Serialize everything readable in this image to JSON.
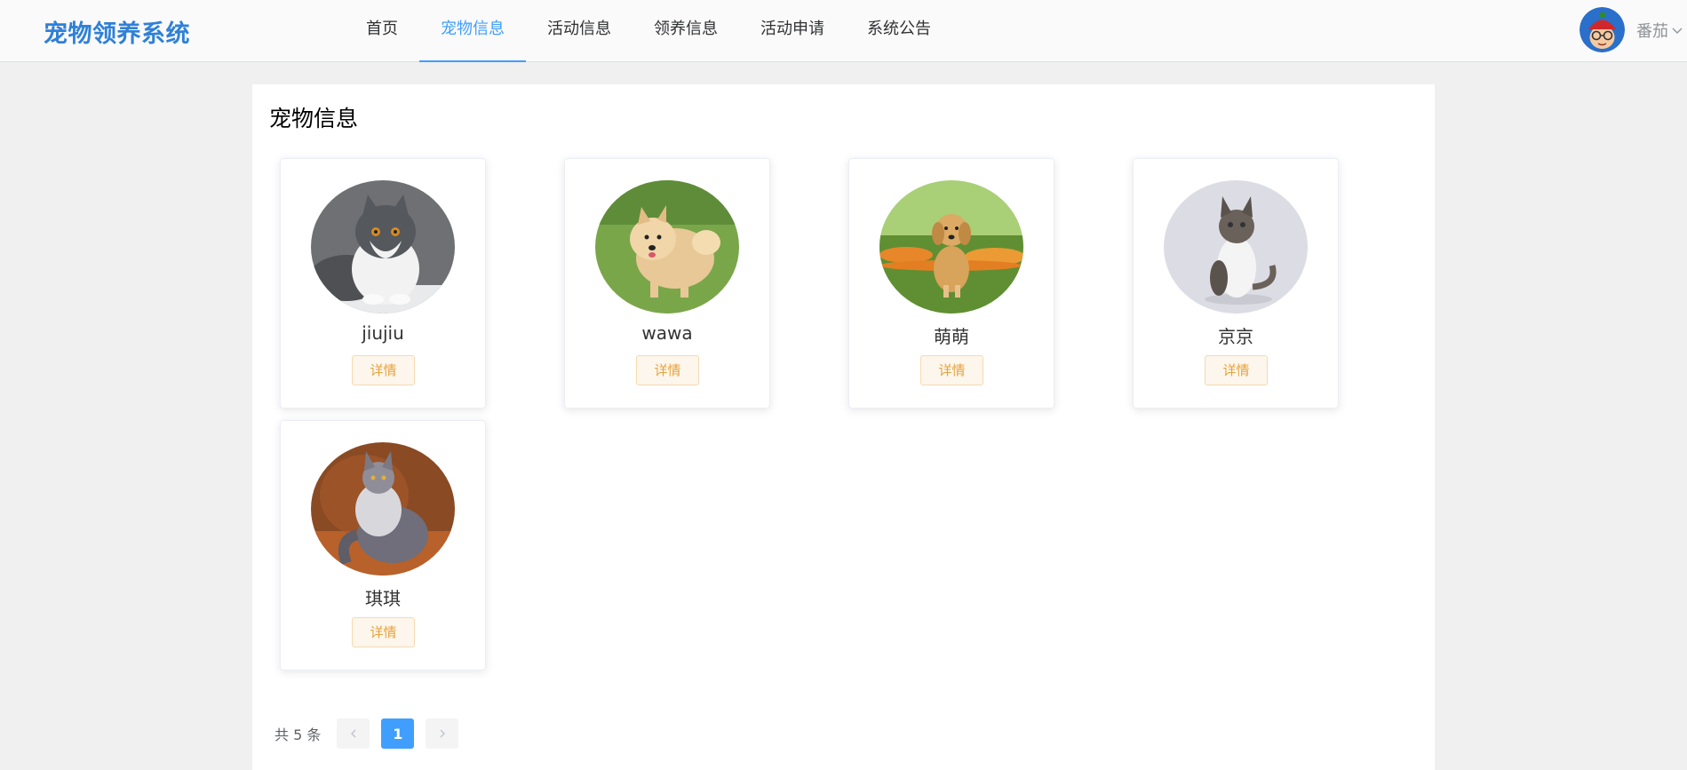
{
  "app": {
    "title": "宠物领养系统"
  },
  "nav": {
    "items": [
      {
        "label": "首页"
      },
      {
        "label": "宠物信息",
        "active": true
      },
      {
        "label": "活动信息"
      },
      {
        "label": "领养信息"
      },
      {
        "label": "活动申请"
      },
      {
        "label": "系统公告"
      }
    ]
  },
  "user": {
    "name": "番茄",
    "dropdown_icon": "chevron-down-icon"
  },
  "main": {
    "title": "宠物信息",
    "pets": [
      {
        "name": "jiujiu",
        "button": "详情",
        "photo": "grey-white-shorthair-cat"
      },
      {
        "name": "wawa",
        "button": "详情",
        "photo": "cream-pomeranian-dog-on-grass"
      },
      {
        "name": "萌萌",
        "button": "详情",
        "photo": "golden-retriever-puppy-in-flowers"
      },
      {
        "name": "京京",
        "button": "详情",
        "photo": "tabby-white-kitten"
      },
      {
        "name": "琪琪",
        "button": "详情",
        "photo": "grey-long-hair-cat-on-orange"
      }
    ]
  },
  "pagination": {
    "total_text": "共 5 条",
    "current_page": "1"
  },
  "colors": {
    "brand": "#2f80d8",
    "active_nav": "#409eff",
    "warning_text": "#e6a23c",
    "page_bg": "#f0f0f0"
  }
}
